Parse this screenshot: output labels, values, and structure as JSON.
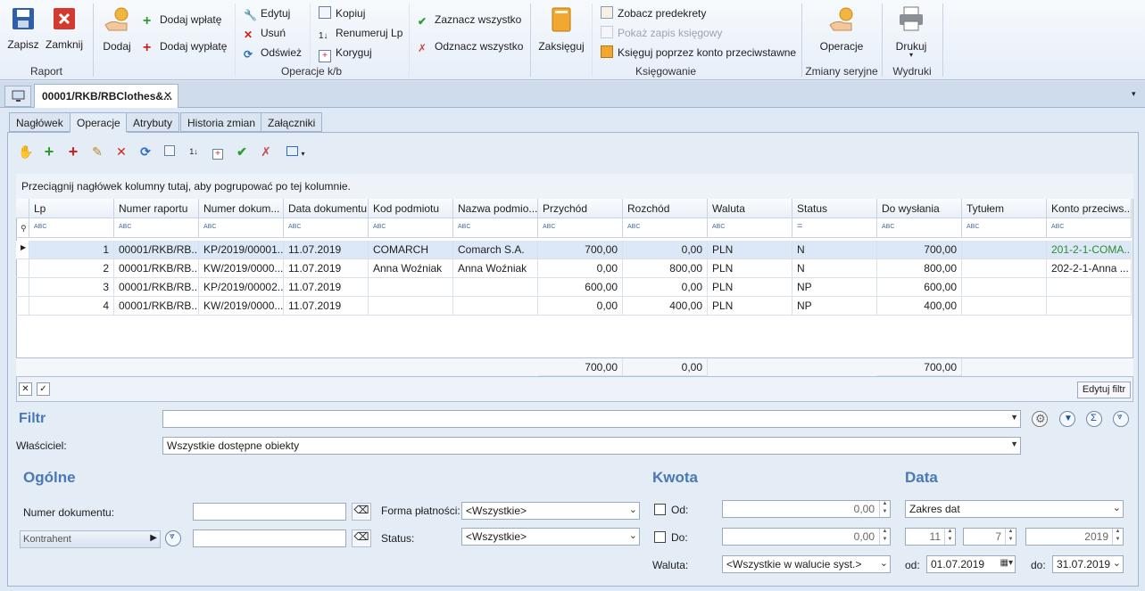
{
  "ribbon": {
    "raport": {
      "save": "Zapisz",
      "close": "Zamknij",
      "group": "Raport"
    },
    "operacje_kb": {
      "add": "Dodaj",
      "add_in": "Dodaj wpłatę",
      "add_out": "Dodaj wypłatę",
      "edit": "Edytuj",
      "delete": "Usuń",
      "refresh": "Odśwież",
      "copy": "Kopiuj",
      "renumber": "Renumeruj Lp",
      "correct": "Koryguj",
      "select_all": "Zaznacz wszystko",
      "deselect_all": "Odznacz wszystko",
      "group": "Operacje k/b"
    },
    "ksiegowanie": {
      "post": "Zaksięguj",
      "see_predecrees": "Zobacz predekrety",
      "show_entry": "Pokaż zapis księgowy",
      "post_contra": "Księguj poprzez konto przeciwstawne",
      "group": "Księgowanie"
    },
    "zmiany": {
      "operations": "Operacje",
      "group": "Zmiany seryjne"
    },
    "wydruki": {
      "print": "Drukuj",
      "group": "Wydruki"
    }
  },
  "doc_tab": {
    "title": "00001/RKB/RBClothes&..."
  },
  "tabs": [
    "Nagłówek",
    "Operacje",
    "Atrybuty",
    "Historia zmian",
    "Załączniki"
  ],
  "grid": {
    "group_hint": "Przeciągnij nagłówek kolumny tutaj, aby pogrupować po tej kolumnie.",
    "columns": [
      "Lp",
      "Numer raportu",
      "Numer dokum...",
      "Data dokumentu",
      "Kod podmiotu",
      "Nazwa podmio...",
      "Przychód",
      "Rozchód",
      "Waluta",
      "Status",
      "Do wysłania",
      "Tytułem",
      "Konto przeciws..."
    ],
    "filter_placeholder": "ABC",
    "filter_status": "=",
    "rows": [
      {
        "lp": "1",
        "nr_raportu": "00001/RKB/RB...",
        "nr_dok": "KP/2019/00001...",
        "data": "11.07.2019",
        "kod": "COMARCH",
        "nazwa": "Comarch S.A.",
        "przychod": "700,00",
        "rozchod": "0,00",
        "waluta": "PLN",
        "status": "N",
        "do_wyslania": "700,00",
        "tytulem": "",
        "konto": "201-2-1-COMA..."
      },
      {
        "lp": "2",
        "nr_raportu": "00001/RKB/RB...",
        "nr_dok": "KW/2019/0000...",
        "data": "11.07.2019",
        "kod": "Anna Woźniak",
        "nazwa": "Anna Woźniak",
        "przychod": "0,00",
        "rozchod": "800,00",
        "waluta": "PLN",
        "status": "N",
        "do_wyslania": "800,00",
        "tytulem": "",
        "konto": "202-2-1-Anna ..."
      },
      {
        "lp": "3",
        "nr_raportu": "00001/RKB/RB...",
        "nr_dok": "KP/2019/00002...",
        "data": "11.07.2019",
        "kod": "",
        "nazwa": "",
        "przychod": "600,00",
        "rozchod": "0,00",
        "waluta": "PLN",
        "status": "NP",
        "do_wyslania": "600,00",
        "tytulem": "",
        "konto": ""
      },
      {
        "lp": "4",
        "nr_raportu": "00001/RKB/RB...",
        "nr_dok": "KW/2019/0000...",
        "data": "11.07.2019",
        "kod": "",
        "nazwa": "",
        "przychod": "0,00",
        "rozchod": "400,00",
        "waluta": "PLN",
        "status": "NP",
        "do_wyslania": "400,00",
        "tytulem": "",
        "konto": ""
      }
    ],
    "sums": {
      "przychod": "700,00",
      "rozchod": "0,00",
      "do_wyslania": "700,00"
    },
    "edit_filter": "Edytuj filtr"
  },
  "filter": {
    "label": "Filtr",
    "value": "",
    "owner_label": "Właściciel:",
    "owner_value": "Wszystkie dostępne obiekty"
  },
  "general": {
    "title": "Ogólne",
    "doc_number_label": "Numer dokumentu:",
    "contractor_label": "Kontrahent",
    "payment_form_label": "Forma płatności:",
    "payment_form_value": "<Wszystkie>",
    "status_label": "Status:",
    "status_value": "<Wszystkie>"
  },
  "amount": {
    "title": "Kwota",
    "from_label": "Od:",
    "from_value": "0,00",
    "to_label": "Do:",
    "to_value": "0,00",
    "currency_label": "Waluta:",
    "currency_value": "<Wszystkie w walucie syst.>"
  },
  "date": {
    "title": "Data",
    "range_value": "Zakres dat",
    "month": "11",
    "day": "7",
    "year": "2019",
    "from_label": "od:",
    "from_value": "01.07.2019",
    "to_label": "do:",
    "to_value": "31.07.2019"
  },
  "colors": {
    "accent": "#4a78b5",
    "link_green": "#2e8b2e",
    "delete_red": "#d22020"
  }
}
